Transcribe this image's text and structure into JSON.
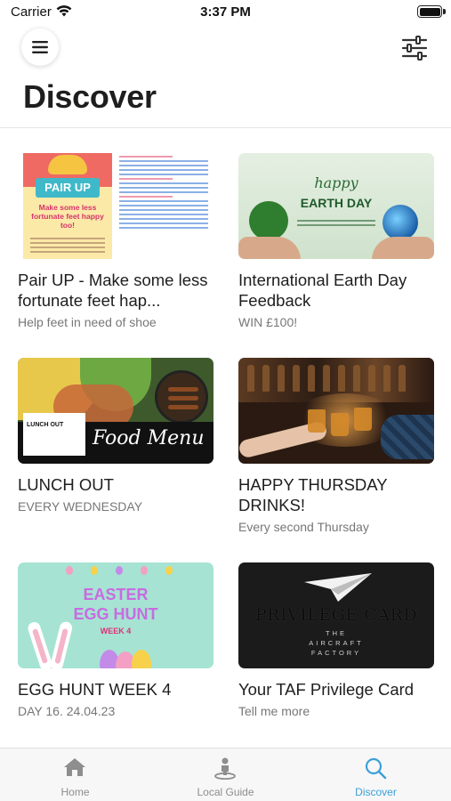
{
  "status_bar": {
    "carrier": "Carrier",
    "time": "3:37 PM"
  },
  "header": {
    "title": "Discover",
    "menu_icon": "hamburger-icon",
    "filter_icon": "sliders-icon"
  },
  "cards": [
    {
      "title": "Pair UP - Make some less fortunate feet hap...",
      "subtitle": "Help feet in need of shoe",
      "thumb": {
        "badge": "PAIR UP",
        "tagline": "Make some less fortunate feet happy too!"
      }
    },
    {
      "title": "International Earth Day Feedback",
      "subtitle": "WIN £100!",
      "thumb": {
        "happy": "happy",
        "day": "EARTH DAY"
      }
    },
    {
      "title": "LUNCH OUT",
      "subtitle": "EVERY WEDNESDAY",
      "thumb": {
        "logo": "LUNCH OUT",
        "script": "Food Menu"
      }
    },
    {
      "title": "HAPPY THURSDAY DRINKS!",
      "subtitle": "Every second Thursday",
      "thumb": {}
    },
    {
      "title": "EGG HUNT WEEK 4",
      "subtitle": "DAY 16. 24.04.23",
      "thumb": {
        "line1": "EASTER",
        "line2": "EGG HUNT",
        "week": "WEEK 4"
      }
    },
    {
      "title": "Your TAF Privilege Card",
      "subtitle": "Tell me more",
      "thumb": {
        "brand": "PRIVILEGE CARD",
        "line1": "THE",
        "line2": "AIRCRAFT",
        "line3": "FACTORY"
      }
    }
  ],
  "tab_bar": {
    "tabs": [
      {
        "label": "Home",
        "icon": "home-icon",
        "active": false
      },
      {
        "label": "Local Guide",
        "icon": "map-pin-person-icon",
        "active": false
      },
      {
        "label": "Discover",
        "icon": "search-icon",
        "active": true
      }
    ]
  },
  "colors": {
    "accent": "#3aa0d8",
    "title": "#1e1e1e",
    "subtitle": "#777777"
  }
}
